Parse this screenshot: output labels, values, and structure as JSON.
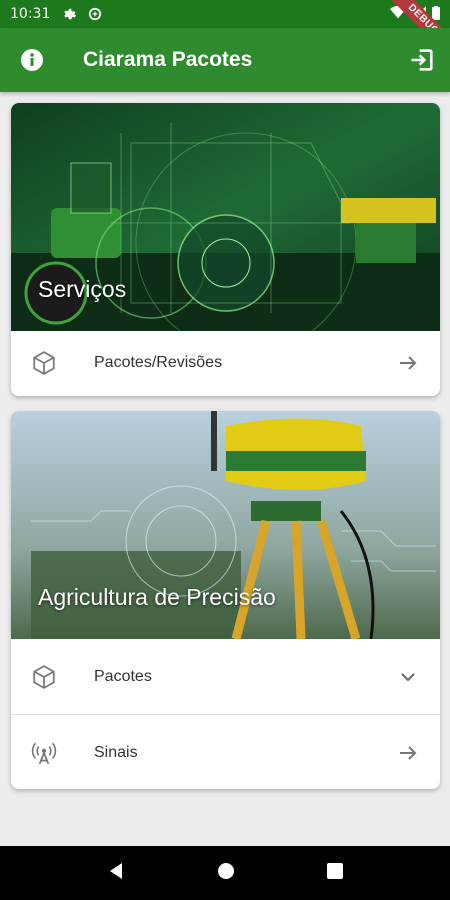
{
  "status_bar": {
    "time": "10:31",
    "ribbon": "DEBUG"
  },
  "app_bar": {
    "title": "Ciarama Pacotes"
  },
  "cards": [
    {
      "title": "Serviços",
      "items": [
        {
          "label": "Pacotes/Revisões",
          "icon": "package-icon",
          "trailing": "arrow-right-icon"
        }
      ]
    },
    {
      "title": "Agricultura de Precisão",
      "items": [
        {
          "label": "Pacotes",
          "icon": "package-icon",
          "trailing": "chevron-down-icon"
        },
        {
          "label": "Sinais",
          "icon": "signal-tower-icon",
          "trailing": "arrow-right-icon"
        }
      ]
    }
  ],
  "colors": {
    "status_bar": "#1c7a1c",
    "app_bar": "#2e8b2e",
    "background": "#ececec"
  }
}
